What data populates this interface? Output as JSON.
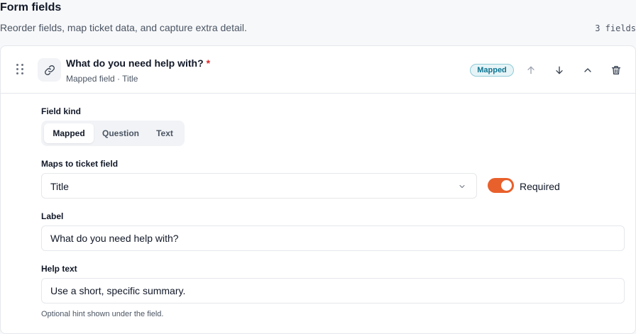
{
  "section": {
    "title": "Form fields",
    "subtitle": "Reorder fields, map ticket data, and capture extra detail.",
    "field_count": "3 fields"
  },
  "field": {
    "title": "What do you need help with?",
    "required_mark": "*",
    "meta": "Mapped field · Title",
    "badge": "Mapped",
    "kind_label": "Field kind",
    "kinds": [
      "Mapped",
      "Question",
      "Text"
    ],
    "active_kind": "Mapped",
    "maps_label": "Maps to ticket field",
    "maps_value": "Title",
    "required_label": "Required",
    "required_on": true,
    "label_label": "Label",
    "label_value": "What do you need help with?",
    "help_label": "Help text",
    "help_value": "Use a short, specific summary.",
    "help_hint": "Optional hint shown under the field."
  },
  "icons": {
    "drag": "drag-handle-icon",
    "link": "link-icon",
    "move_up": "arrow-up-icon",
    "move_down": "arrow-down-icon",
    "collapse": "chevron-up-icon",
    "delete": "trash-icon",
    "select": "chevron-down-icon"
  },
  "colors": {
    "accent": "#e8602c",
    "badge_bg": "#e6f4f7",
    "badge_text": "#0e7490",
    "required": "#dc2626"
  }
}
